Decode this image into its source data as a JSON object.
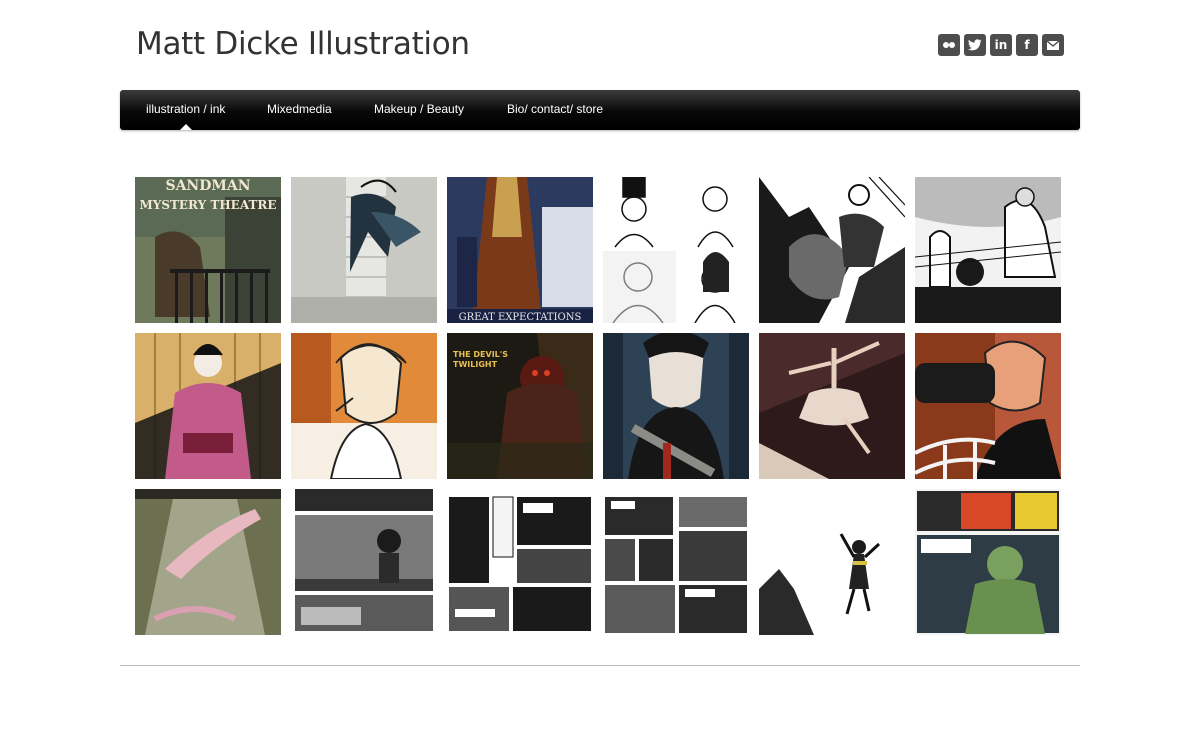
{
  "site": {
    "title": "Matt Dicke Illustration"
  },
  "social": [
    {
      "name": "flickr",
      "icon": "flickr-icon"
    },
    {
      "name": "twitter",
      "icon": "twitter-icon"
    },
    {
      "name": "linkedin",
      "icon": "linkedin-icon",
      "glyph": "in"
    },
    {
      "name": "facebook",
      "icon": "facebook-icon",
      "glyph": "f"
    },
    {
      "name": "email",
      "icon": "envelope-icon"
    }
  ],
  "nav": {
    "items": [
      {
        "label": "illustration / ink",
        "active": true
      },
      {
        "label": "Mixedmedia"
      },
      {
        "label": "Makeup / Beauty"
      },
      {
        "label": "Bio/ contact/ store"
      }
    ]
  },
  "gallery": {
    "thumbnails": [
      {
        "name": "thumb-sandman-mystery-theatre",
        "text_lines": [
          "SANDMAN",
          "MYSTERY THEATRE"
        ]
      },
      {
        "name": "thumb-skyscraper-hero"
      },
      {
        "name": "thumb-great-expectations",
        "text_lines": [
          "GREAT EXPECTATIONS"
        ]
      },
      {
        "name": "thumb-victorian-portraits"
      },
      {
        "name": "thumb-ink-figures"
      },
      {
        "name": "thumb-ink-interior"
      },
      {
        "name": "thumb-geisha"
      },
      {
        "name": "thumb-woman-smoking"
      },
      {
        "name": "thumb-devils-twilight",
        "text_lines": [
          "THE DEVIL'S",
          "TWILIGHT"
        ]
      },
      {
        "name": "thumb-bandit-portrait"
      },
      {
        "name": "thumb-ballerina"
      },
      {
        "name": "thumb-woman-with-camera"
      },
      {
        "name": "thumb-floating-figure"
      },
      {
        "name": "thumb-comic-page-1"
      },
      {
        "name": "thumb-comic-page-2"
      },
      {
        "name": "thumb-comic-page-3"
      },
      {
        "name": "thumb-falling-man"
      },
      {
        "name": "thumb-comic-zombie"
      }
    ]
  },
  "colors": {
    "nav_bg": "#111111",
    "icon_bg": "#4d4d4d",
    "title": "#333333",
    "divider": "#b8b8b8"
  }
}
